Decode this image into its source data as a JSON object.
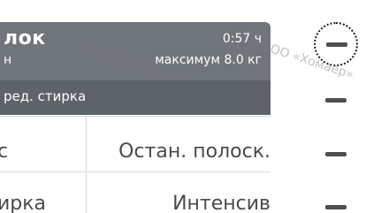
{
  "program": {
    "name": "лок",
    "subtitle": "н",
    "time": "0:57 ч",
    "max_load": "максимум 8.0 кг",
    "option": "ред. стирка"
  },
  "grid": {
    "row1_left": "с",
    "row1_right": "Остан. полоск.",
    "row2_left": "ирка",
    "row2_right": "Интенсив"
  },
  "watermarks": {
    "text1": "ООО «Хомаер»",
    "text2": "ООО «Хомаер»"
  },
  "colors": {
    "card": "#6f757a",
    "strip": "#5d6368",
    "text": "#4a4a4a"
  },
  "icons": {
    "dial": "selected-level-dial-icon",
    "dash": "level-dash-icon"
  }
}
